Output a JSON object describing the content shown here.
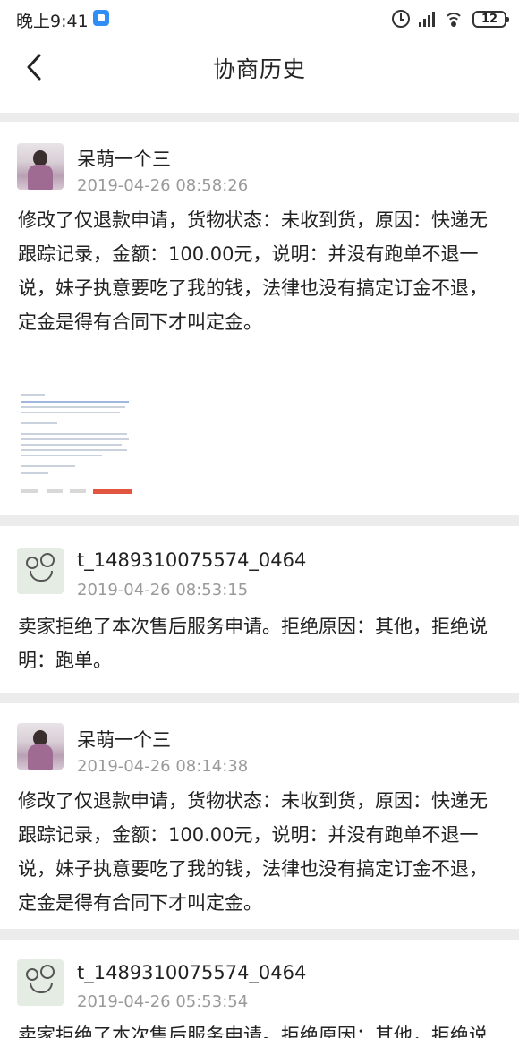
{
  "status_bar": {
    "time": "晚上9:41",
    "battery": "12",
    "icons": [
      "app-notification-icon",
      "alarm-icon",
      "signal-icon",
      "wifi-icon",
      "battery-icon"
    ]
  },
  "header": {
    "title": "协商历史",
    "back_icon": "chevron-left-icon"
  },
  "records": [
    {
      "username": "呆萌一个三",
      "timestamp": "2019-04-26 08:58:26",
      "message": "修改了仅退款申请，货物状态：未收到货，原因：快递无跟踪记录，金额：100.00元，说明：并没有跑单不退一说，妹子执意要吃了我的钱，法律也没有搞定订金不退，定金是得有合同下才叫定金。",
      "has_attachment": true
    },
    {
      "username": "t_1489310075574_0464",
      "timestamp": "2019-04-26 08:53:15",
      "message": "卖家拒绝了本次售后服务申请。拒绝原因：其他，拒绝说明：跑单。"
    },
    {
      "username": "呆萌一个三",
      "timestamp": "2019-04-26 08:14:38",
      "message": "修改了仅退款申请，货物状态：未收到货，原因：快递无跟踪记录，金额：100.00元，说明：并没有跑单不退一说，妹子执意要吃了我的钱，法律也没有搞定订金不退，定金是得有合同下才叫定金。"
    },
    {
      "username": "t_1489310075574_0464",
      "timestamp": "2019-04-26 05:53:54",
      "message": "卖家拒绝了本次售后服务申请。拒绝原因：其他，拒绝说明：跑单。"
    }
  ]
}
